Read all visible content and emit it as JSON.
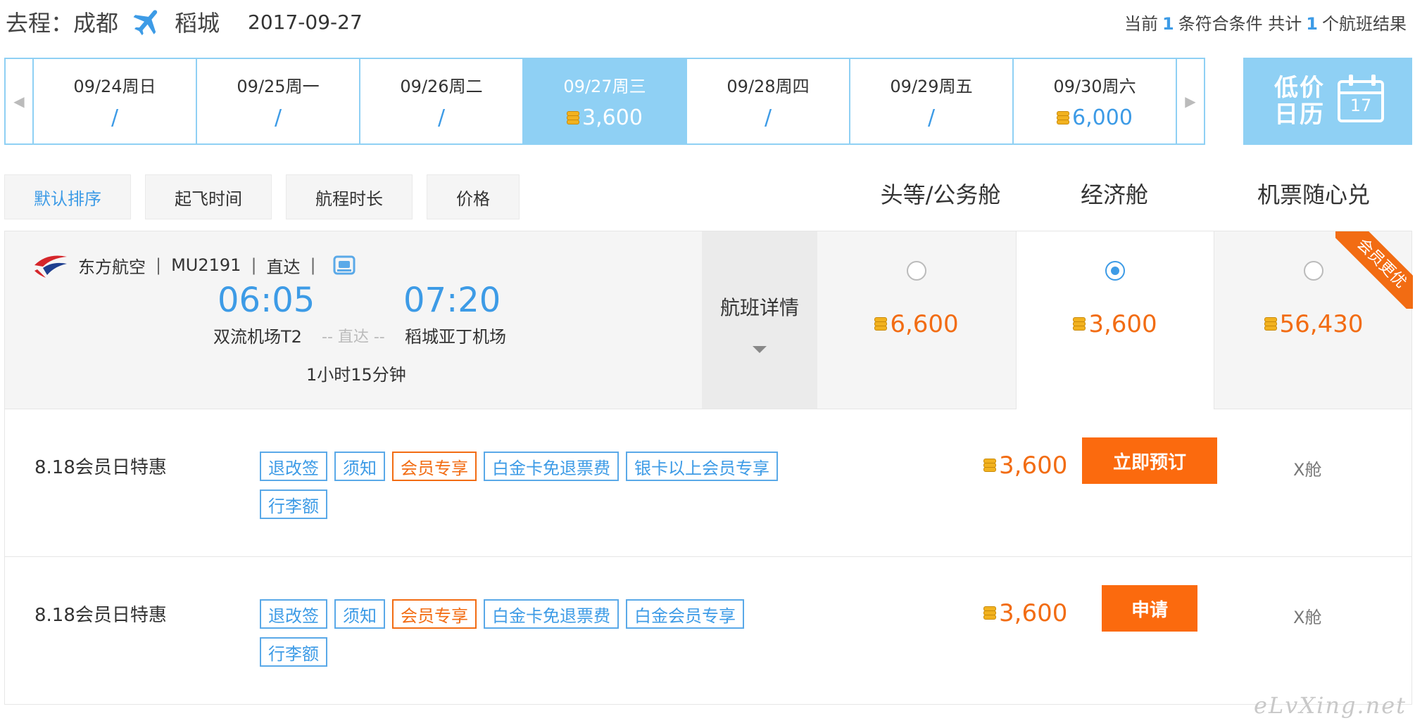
{
  "header": {
    "route_label": "去程：成都",
    "destination": "稻城",
    "date": "2017-09-27",
    "summary_prefix": "当前",
    "summary_count": "1",
    "summary_mid": "条符合条件 共计",
    "summary_total": "1",
    "summary_suffix": "个航班结果"
  },
  "date_strip": {
    "active_index": 3,
    "days": [
      {
        "date": "09/24周日",
        "price": "/"
      },
      {
        "date": "09/25周一",
        "price": "/"
      },
      {
        "date": "09/26周二",
        "price": "/"
      },
      {
        "date": "09/27周三",
        "price": "3,600"
      },
      {
        "date": "09/28周四",
        "price": "/"
      },
      {
        "date": "09/29周五",
        "price": "/"
      },
      {
        "date": "09/30周六",
        "price": "6,000"
      }
    ]
  },
  "calendar_button": {
    "label": "低价日历",
    "day": "17"
  },
  "sort": {
    "default": "默认排序",
    "departure": "起飞时间",
    "duration": "航程时长",
    "price": "价格"
  },
  "columns": {
    "first": "头等/公务舱",
    "economy": "经济舱",
    "exchange": "机票随心兑"
  },
  "flight": {
    "airline": "东方航空",
    "number": "MU2191",
    "type": "直达",
    "dep_time": "06:05",
    "arr_time": "07:20",
    "dep_airport": "双流机场T2",
    "arr_airport": "稻城亚丁机场",
    "direct_label": "-- 直达 --",
    "duration": "1小时15分钟",
    "detail_label": "航班详情",
    "prices": {
      "first": "6,600",
      "economy": "3,600",
      "exchange": "56,430"
    },
    "selected": "economy",
    "ribbon": "会员更优"
  },
  "fares": [
    {
      "name": "8.18会员日特惠",
      "tags": [
        {
          "label": "退改签",
          "style": "blue"
        },
        {
          "label": "须知",
          "style": "blue"
        },
        {
          "label": "会员专享",
          "style": "orange"
        },
        {
          "label": "白金卡免退票费",
          "style": "blue"
        },
        {
          "label": "银卡以上会员专享",
          "style": "blue"
        },
        {
          "label": "行李额",
          "style": "blue"
        }
      ],
      "price": "3,600",
      "button": "立即预订",
      "class": "X舱"
    },
    {
      "name": "8.18会员日特惠",
      "tags": [
        {
          "label": "退改签",
          "style": "blue"
        },
        {
          "label": "须知",
          "style": "blue"
        },
        {
          "label": "会员专享",
          "style": "orange"
        },
        {
          "label": "白金卡免退票费",
          "style": "blue"
        },
        {
          "label": "白金会员专享",
          "style": "blue"
        },
        {
          "label": "行李额",
          "style": "blue"
        }
      ],
      "price": "3,600",
      "button": "申请",
      "class": "X舱"
    }
  ],
  "watermark": "eLvXing.net",
  "colors": {
    "accent": "#3d9be6",
    "active_date": "#8fd0f4",
    "price": "#f26c13",
    "book": "#fb6a0e"
  },
  "icons": [
    "plane-icon",
    "coin-icon",
    "calendar-icon",
    "airline-logo-icon",
    "seat-icon",
    "radio-icon"
  ]
}
